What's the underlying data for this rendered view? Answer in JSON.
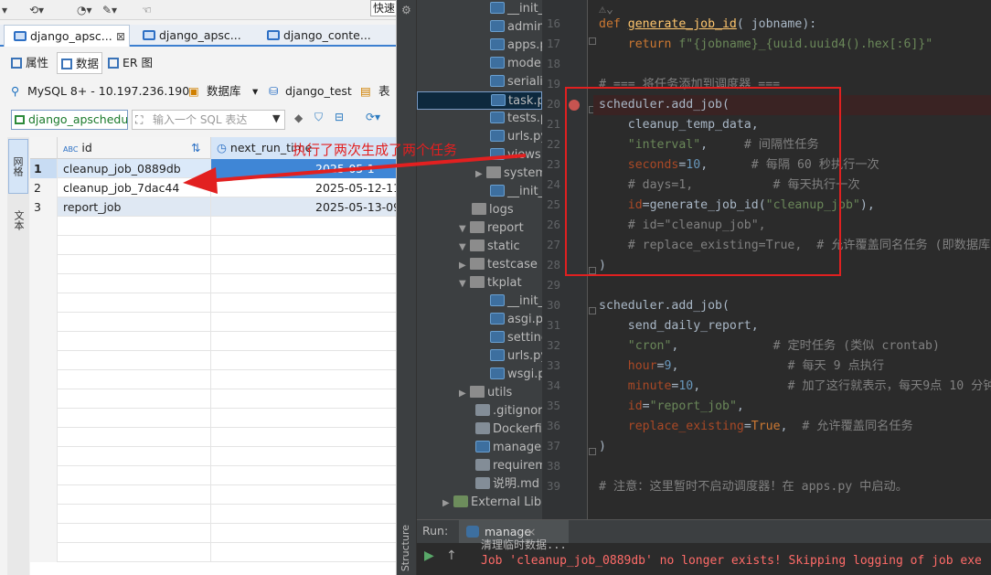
{
  "toolbar": {
    "quick": "快速"
  },
  "tabs": [
    {
      "label": "django_apsc...",
      "close": "⊠"
    },
    {
      "label": "django_apsc..."
    },
    {
      "label": "django_conte..."
    }
  ],
  "subtabs": [
    {
      "label": "属性"
    },
    {
      "label": "数据"
    },
    {
      "label": "ER 图"
    }
  ],
  "connection": {
    "server": "MySQL 8+ - 10.197.236.190",
    "db_label": "数据库",
    "db_name": "django_test",
    "table_label": "表"
  },
  "sql": {
    "table": "django_apschedul",
    "placeholder": "输入一个 SQL 表达"
  },
  "sidebar": {
    "grid": "网格",
    "text": "文本"
  },
  "grid": {
    "columns": [
      "id",
      "next_run_time"
    ],
    "rows": [
      {
        "n": "1",
        "id": "cleanup_job_0889db",
        "next": "2025-05-1"
      },
      {
        "n": "2",
        "id": "cleanup_job_7dac44",
        "next": "2025-05-12-11."
      },
      {
        "n": "3",
        "id": "report_job",
        "next": "2025-05-13-09."
      }
    ]
  },
  "annotation": "执行了两次生成了两个任务",
  "project": {
    "items": [
      "__init__",
      "admin",
      "apps.py",
      "model",
      "serializ",
      "task.py",
      "tests.py",
      "urls.py",
      "views.",
      "system",
      "__init__.py",
      "logs",
      "report",
      "static",
      "testcase",
      "tkplat",
      "__init__.py",
      "asgi.py",
      "settings.p",
      "urls.py",
      "wsgi.py",
      "utils",
      ".gitignore",
      "Dockerfile",
      "manage.py",
      "requirement",
      "说明.md",
      "External Librarie"
    ]
  },
  "code": {
    "line_numbers": [
      "16",
      "17",
      "18",
      "19",
      "20",
      "21",
      "22",
      "23",
      "24",
      "25",
      "26",
      "27",
      "28",
      "29",
      "30",
      "31",
      "32",
      "33",
      "34",
      "35",
      "36",
      "37",
      "38",
      "39"
    ],
    "l16_def": "def ",
    "l16_name": "generate_job_id",
    "l16_args": "( jobname):",
    "l17_return": "return ",
    "l17_str": "f\"{jobname}_{uuid.uuid4().hex[:6]}\"",
    "l19": "# === 将任务添加到调度器 ===",
    "l20": "scheduler.add_job(",
    "l21": "    cleanup_temp_data,",
    "l22_str": "\"interval\"",
    "l22_cm": "# 间隔性任务",
    "l23_p": "seconds",
    "l23_n": "10",
    "l23_cm": "# 每隔 60 秒执行一次",
    "l24": "# days=1,           # 每天执行一次",
    "l25_p": "id",
    "l25_fn": "generate_job_id(",
    "l25_str": "\"cleanup_job\"",
    "l26": "# id=\"cleanup_job\",",
    "l27": "# replace_existing=True,  # 允许覆盖同名任务 (即数据库",
    "l28": ")",
    "l30": "scheduler.add_job(",
    "l31": "    send_daily_report,",
    "l32_str": "\"cron\"",
    "l32_cm": "# 定时任务 (类似 crontab)",
    "l33_p": "hour",
    "l33_n": "9",
    "l33_cm": "# 每天 9 点执行",
    "l34_p": "minute",
    "l34_n": "10",
    "l34_cm": "# 加了这行就表示，每天9点 10 分钟",
    "l35_p": "id",
    "l35_str": "\"report_job\"",
    "l36_p": "replace_existing",
    "l36_kw": "True",
    "l36_cm": "# 允许覆盖同名任务",
    "l37": ")",
    "l39": "# 注意：这里暂时不启动调度器！在 apps.py 中启动。"
  },
  "run": {
    "label": "Run:",
    "config": "manage",
    "close": "×"
  },
  "console": {
    "line1": "清理临时数据...",
    "line2": "Job 'cleanup_job_0889db' no longer exists! Skipping logging of job exe"
  },
  "structure_label": "Structure",
  "colors": {
    "accent": "#3c7fd0",
    "annotation": "#e22020",
    "editor_bg": "#2b2b2b"
  }
}
